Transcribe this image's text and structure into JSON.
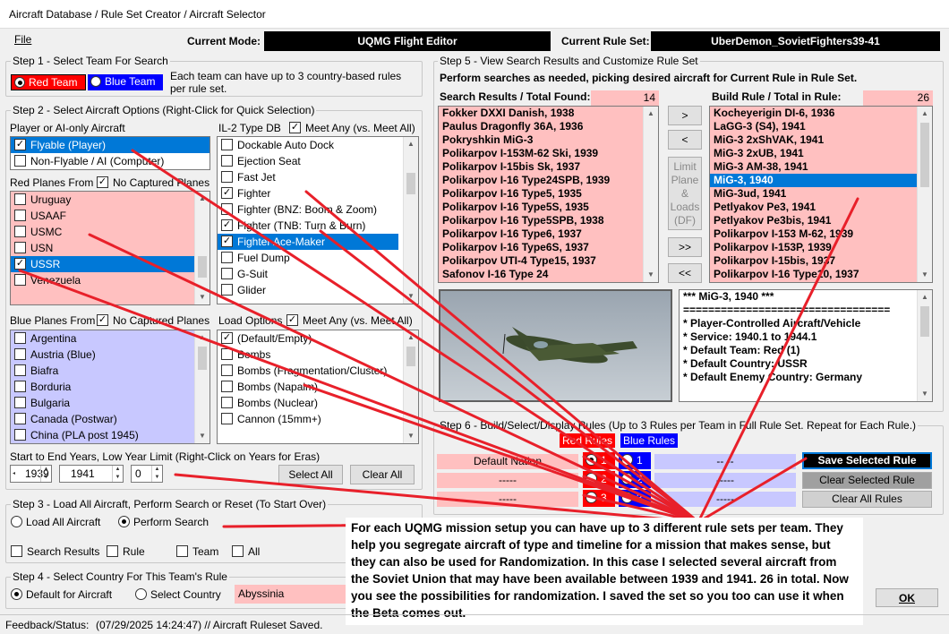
{
  "window": {
    "title": "Aircraft Database / Rule Set Creator / Aircraft Selector"
  },
  "menu": {
    "file": "File"
  },
  "header": {
    "mode_label": "Current Mode:",
    "mode_value": "UQMG Flight Editor",
    "rule_set_label": "Current Rule Set:",
    "rule_set_value": "UberDemon_SovietFighters39-41"
  },
  "step1": {
    "title": "Step 1 - Select Team For Search",
    "red_team": "Red Team",
    "blue_team": "Blue Team",
    "info": "Each team can have up to 3 country-based rules per rule set.",
    "colors": {
      "red": "#ff0000",
      "blue": "#0000ff"
    }
  },
  "step2": {
    "title": "Step 2 - Select Aircraft Options (Right-Click for Quick Selection)",
    "player_label": "Player or AI-only Aircraft",
    "player_items": [
      {
        "label": "Flyable (Player)",
        "checked": true,
        "selected": true
      },
      {
        "label": "Non-Flyable / AI (Computer)",
        "checked": false,
        "selected": false
      }
    ],
    "type_db_label": "IL-2 Type DB",
    "meet_any_label": "Meet Any (vs. Meet All)",
    "type_items": [
      {
        "label": "Dockable Auto Dock",
        "checked": false
      },
      {
        "label": "Ejection Seat",
        "checked": false
      },
      {
        "label": "Fast Jet",
        "checked": false
      },
      {
        "label": "Fighter",
        "checked": true
      },
      {
        "label": "Fighter (BNZ: Boom & Zoom)",
        "checked": false
      },
      {
        "label": "Fighter (TNB: Turn & Burn)",
        "checked": true
      },
      {
        "label": "Fighter Ace-Maker",
        "checked": true,
        "selected": true
      },
      {
        "label": "Fuel Dump",
        "checked": false
      },
      {
        "label": "G-Suit",
        "checked": false
      },
      {
        "label": "Glider",
        "checked": false
      }
    ],
    "red_planes_label": "Red Planes From",
    "no_captured_label": "No Captured Planes",
    "red_countries": [
      {
        "label": "Uruguay",
        "checked": false
      },
      {
        "label": "USAAF",
        "checked": false
      },
      {
        "label": "USMC",
        "checked": false
      },
      {
        "label": "USN",
        "checked": false
      },
      {
        "label": "USSR",
        "checked": true,
        "selected": true
      },
      {
        "label": "Venezuela",
        "checked": false
      }
    ],
    "blue_planes_label": "Blue Planes From",
    "blue_no_captured_label": "No Captured Planes",
    "blue_countries": [
      {
        "label": "Argentina",
        "checked": false
      },
      {
        "label": "Austria (Blue)",
        "checked": false
      },
      {
        "label": "Biafra",
        "checked": false
      },
      {
        "label": "Borduria",
        "checked": false
      },
      {
        "label": "Bulgaria",
        "checked": false
      },
      {
        "label": "Canada (Postwar)",
        "checked": false
      },
      {
        "label": "China (PLA post 1945)",
        "checked": false
      }
    ],
    "load_options_label": "Load Options",
    "load_meet_any_label": "Meet Any (vs. Meet All)",
    "load_items": [
      {
        "label": "(Default/Empty)",
        "checked": true
      },
      {
        "label": "Bombs",
        "checked": false
      },
      {
        "label": "Bombs (Fragmentation/Cluster)",
        "checked": false
      },
      {
        "label": "Bombs (Napalm)",
        "checked": false
      },
      {
        "label": "Bombs (Nuclear)",
        "checked": false
      },
      {
        "label": "Cannon (15mm+)",
        "checked": false
      }
    ],
    "years_label": "Start to End Years, Low Year Limit (Right-Click on Years for Eras)",
    "start_year": "1939",
    "end_year": "1941",
    "low_limit": "0",
    "select_all": "Select All",
    "clear_all": "Clear All"
  },
  "step3": {
    "title": "Step 3 - Load All Aircraft, Perform Search or Reset (To Start Over)",
    "load_all": "Load All Aircraft",
    "perform_search": "Perform Search",
    "clear_options": [
      "Search Results",
      "Rule",
      "Team",
      "All"
    ]
  },
  "step4": {
    "title": "Step 4 - Select Country For This Team's Rule",
    "default_option": "Default for Aircraft",
    "select_option": "Select Country",
    "country_value": "Abyssinia"
  },
  "step5": {
    "title": "Step 5 - View Search Results and Customize Rule Set",
    "info": "Perform searches as needed, picking desired aircraft for Current Rule in Rule Set.",
    "search_label": "Search Results / Total Found:",
    "search_total": "14",
    "search_results": [
      "Fokker DXXI Danish, 1938",
      "Paulus Dragonfly 36A, 1936",
      "Pokryshkin MiG-3",
      "Polikarpov I-153M-62 Ski, 1939",
      "Polikarpov I-15bis Sk, 1937",
      "Polikarpov I-16 Type24SPB, 1939",
      "Polikarpov I-16 Type5, 1935",
      "Polikarpov I-16 Type5S, 1935",
      "Polikarpov I-16 Type5SPB, 1938",
      "Polikarpov I-16 Type6, 1937",
      "Polikarpov I-16 Type6S, 1937",
      "Polikarpov UTI-4 Type15, 1937",
      "Safonov I-16 Type 24"
    ],
    "btn_add": ">",
    "btn_remove": "<",
    "limit_label": "Limit Plane & Loads (DF)",
    "btn_add_all": ">>",
    "btn_remove_all": "<<",
    "build_label": "Build Rule / Total in Rule:",
    "build_total": "26",
    "build_rule": [
      "Kocheyerigin DI-6, 1936",
      "LaGG-3 (S4), 1941",
      "MiG-3 2xShVAK, 1941",
      "MiG-3 2xUB, 1941",
      "MiG-3 AM-38, 1941",
      "MiG-3, 1940",
      "MiG-3ud, 1941",
      "Petlyakov Pe3, 1941",
      "Petlyakov Pe3bis, 1941",
      "Polikarpov I-153 M-62, 1939",
      "Polikarpov I-153P, 1939",
      "Polikarpov I-15bis, 1937",
      "Polikarpov I-16 Type10, 1937"
    ],
    "build_selected_index": 5,
    "details": [
      "*** MiG-3, 1940 ***",
      "=================================",
      "* Player-Controlled Aircraft/Vehicle",
      "* Service: 1940.1 to 1944.1",
      "* Default Team: Red (1)",
      "* Default Country: USSR",
      "* Default Enemy Country: Germany"
    ]
  },
  "step6": {
    "title": "Step 6 - Build/Select/Display Rules (Up to 3 Rules per Team in Full Rule Set.  Repeat for Each Rule.)",
    "red_rules": "Red Rules",
    "blue_rules": "Blue Rules",
    "red_rows": [
      "Default Nation",
      "-----",
      "-----"
    ],
    "blue_rows": [
      "-- --",
      "-----",
      "-----"
    ],
    "numbers": [
      "1",
      "2",
      "3"
    ],
    "save_selected": "Save Selected Rule",
    "clear_selected": "Clear Selected Rule",
    "clear_all_rules": "Clear All Rules"
  },
  "ok_button": "OK",
  "overlay": {
    "text": "For each UQMG mission setup you can have up to 3 different rule sets per team. They help you segregate aircraft of type and timeline for a mission that makes sense, but they can also be used for Randomization.  In this case I selected several aircraft from the Soviet Union that may have been available between 1939 and 1941.  26 in total.  Now you see the possibilities for randomization.  I saved the set so you too can use it when the Beta comes out."
  },
  "status": {
    "label": "Feedback/Status:",
    "text": "(07/29/2025 14:24:47) // Aircraft Ruleset Saved."
  }
}
